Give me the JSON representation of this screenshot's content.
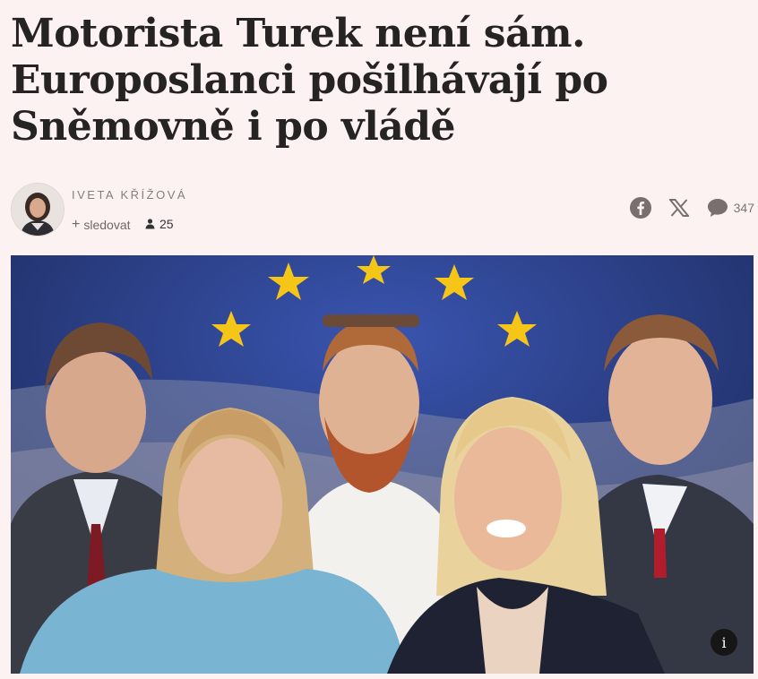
{
  "article": {
    "title": "Motorista Turek není sám. Europoslanci pošilhávají po Sněmovně i po vládě"
  },
  "author": {
    "name": "IVETA KŘÍŽOVÁ",
    "follow_label": "sledovat",
    "followers_count": "25"
  },
  "share": {
    "comment_count": "347",
    "icons": [
      "facebook-icon",
      "x-icon",
      "comment-icon"
    ],
    "icon_color": "#7a6f6f"
  },
  "hero": {
    "info_label": "i"
  },
  "colors": {
    "background": "#fdf2f2",
    "headline": "#262323",
    "eu_blue": "#2c4390",
    "eu_star": "#f5c518"
  }
}
